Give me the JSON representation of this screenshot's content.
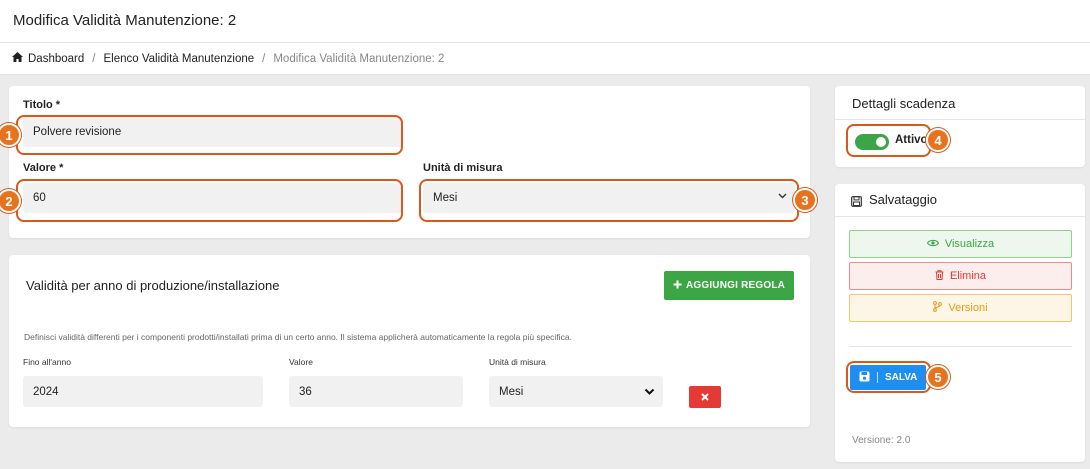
{
  "header": {
    "title": "Modifica Validità Manutenzione: 2"
  },
  "breadcrumb": {
    "items": [
      "Dashboard",
      "Elenco Validità Manutenzione",
      "Modifica Validità Manutenzione: 2"
    ],
    "separator": "/"
  },
  "form": {
    "titolo_label": "Titolo *",
    "titolo_value": "Polvere revisione",
    "valore_label": "Valore *",
    "valore_value": "60",
    "unita_label": "Unità di misura",
    "unita_value": "Mesi"
  },
  "rules": {
    "title": "Validità per anno di produzione/installazione",
    "add_button": "AGGIUNGI REGOLA",
    "description": "Definisci validità differenti per i componenti prodotti/installati prima di un certo anno. Il sistema applicherà automaticamente la regola più specifica.",
    "columns": [
      "Fino all'anno",
      "Valore",
      "Unità di misura"
    ],
    "rows": [
      {
        "anno": "2024",
        "valore": "36",
        "unita": "Mesi"
      }
    ]
  },
  "sidebar": {
    "scadenza_title": "Dettagli scadenza",
    "attivo_label": "Attivo",
    "attivo_on": true,
    "salvataggio_title": "Salvataggio",
    "visualizza": "Visualizza",
    "elimina": "Elimina",
    "versioni": "Versioni",
    "salva": "SALVA",
    "version_text": "Versione: 2.0"
  },
  "annotations": [
    "1",
    "2",
    "3",
    "4",
    "5"
  ],
  "colors": {
    "accent": "#d9581b",
    "green": "#3ca545",
    "red": "#e53935",
    "orange": "#e89b12",
    "blue": "#1f8ef1"
  },
  "icons": [
    "home-icon",
    "plus-icon",
    "chevron-down-icon",
    "close-icon",
    "save-disk-icon",
    "eye-icon",
    "trash-icon",
    "branch-icon"
  ]
}
